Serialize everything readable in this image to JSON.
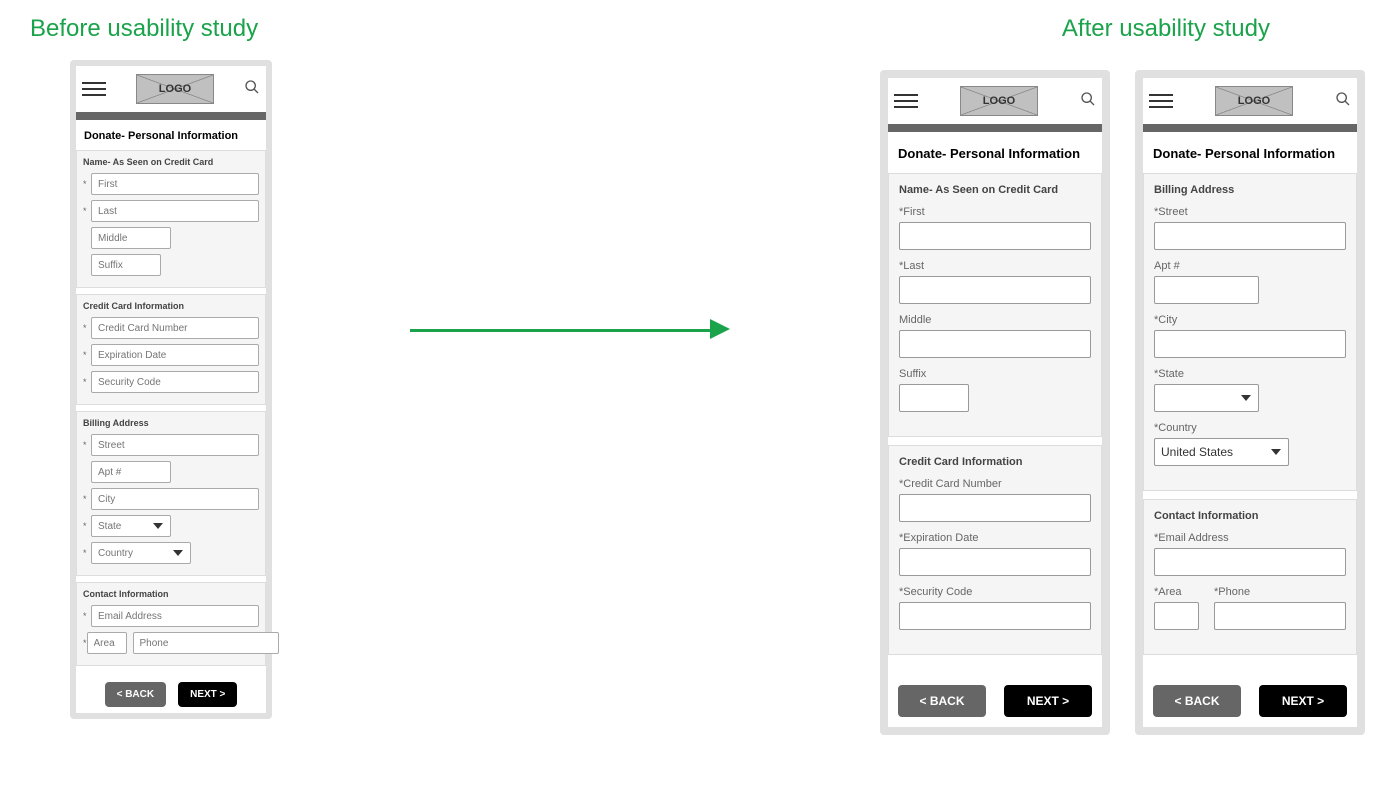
{
  "titles": {
    "before": "Before usability study",
    "after": "After usability study"
  },
  "logo": "LOGO",
  "page_title": "Donate- Personal Information",
  "before": {
    "name_section": {
      "title": "Name- As Seen on Credit Card",
      "fields": [
        "First",
        "Last",
        "Middle",
        "Suffix"
      ]
    },
    "card_section": {
      "title": "Credit Card Information",
      "fields": [
        "Credit Card Number",
        "Expiration Date",
        "Security Code"
      ]
    },
    "billing_section": {
      "title": "Billing Address",
      "street": "Street",
      "apt": "Apt #",
      "city": "City",
      "state": "State",
      "country": "Country"
    },
    "contact_section": {
      "title": "Contact Information",
      "email": "Email Address",
      "area": "Area",
      "phone": "Phone"
    }
  },
  "after1": {
    "name_section": {
      "title": "Name- As Seen on Credit Card",
      "first": "*First",
      "last": "*Last",
      "middle": "Middle",
      "suffix": "Suffix"
    },
    "card_section": {
      "title": "Credit Card Information",
      "ccn": "*Credit Card Number",
      "exp": "*Expiration Date",
      "sec": "*Security Code"
    }
  },
  "after2": {
    "billing_section": {
      "title": "Billing Address",
      "street": "*Street",
      "apt": "Apt #",
      "city": "*City",
      "state": "*State",
      "country": "*Country",
      "country_value": "United States"
    },
    "contact_section": {
      "title": "Contact Information",
      "email": "*Email Address",
      "area": "*Area",
      "phone": "*Phone"
    }
  },
  "back_btn": "<  BACK",
  "next_btn": "NEXT  >"
}
